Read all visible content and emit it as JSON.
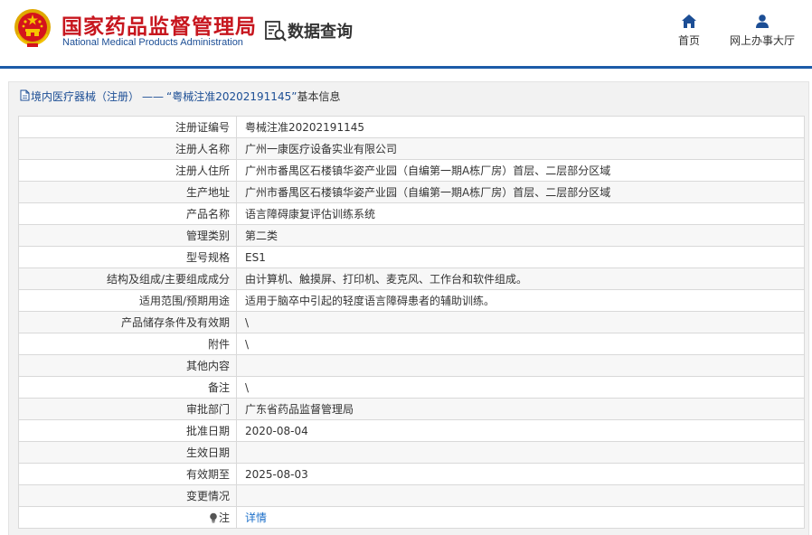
{
  "header": {
    "org_cn": "国家药品监督管理局",
    "org_en": "National Medical Products Administration",
    "query_title": "数据查询",
    "nav": [
      {
        "label": "首页",
        "icon": "home-icon"
      },
      {
        "label": "网上办事大厅",
        "icon": "user-icon"
      }
    ]
  },
  "breadcrumb": {
    "section": "境内医疗器械（注册）",
    "separator": "——",
    "current": "“粤械注准20202191145”",
    "suffix": "基本信息"
  },
  "details": [
    {
      "label": "注册证编号",
      "value": "粤械注准20202191145"
    },
    {
      "label": "注册人名称",
      "value": "广州一康医疗设备实业有限公司"
    },
    {
      "label": "注册人住所",
      "value": "广州市番禺区石楼镇华姿产业园（自编第一期A栋厂房）首层、二层部分区域"
    },
    {
      "label": "生产地址",
      "value": "广州市番禺区石楼镇华姿产业园（自编第一期A栋厂房）首层、二层部分区域"
    },
    {
      "label": "产品名称",
      "value": "语言障碍康复评估训练系统"
    },
    {
      "label": "管理类别",
      "value": "第二类"
    },
    {
      "label": "型号规格",
      "value": "ES1"
    },
    {
      "label": "结构及组成/主要组成成分",
      "value": "由计算机、触摸屏、打印机、麦克风、工作台和软件组成。"
    },
    {
      "label": "适用范围/预期用途",
      "value": "适用于脑卒中引起的轻度语言障碍患者的辅助训练。"
    },
    {
      "label": "产品储存条件及有效期",
      "value": "\\"
    },
    {
      "label": "附件",
      "value": "\\"
    },
    {
      "label": "其他内容",
      "value": ""
    },
    {
      "label": "备注",
      "value": "\\"
    },
    {
      "label": "审批部门",
      "value": "广东省药品监督管理局"
    },
    {
      "label": "批准日期",
      "value": "2020-08-04"
    },
    {
      "label": "生效日期",
      "value": ""
    },
    {
      "label": "有效期至",
      "value": "2025-08-03"
    },
    {
      "label": "变更情况",
      "value": ""
    }
  ],
  "note_row": {
    "label": "注",
    "link": "详情",
    "icon": "lightbulb-icon"
  },
  "colors": {
    "brand_red": "#c7161e",
    "brand_blue": "#1c4e95",
    "link_blue": "#1c6fc9"
  }
}
